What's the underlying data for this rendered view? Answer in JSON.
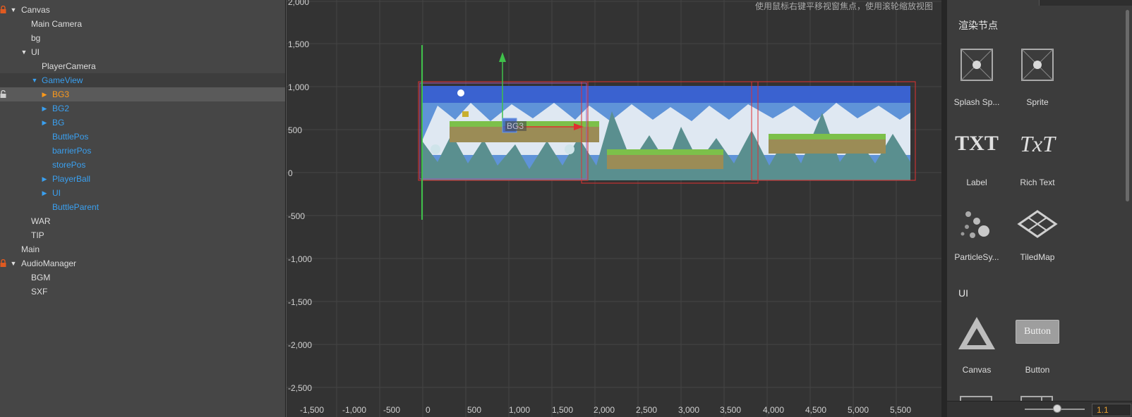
{
  "hierarchy": {
    "nodes": [
      {
        "label": "Canvas",
        "color": "#e6e6e6"
      },
      {
        "label": "Main Camera",
        "color": "#e6e6e6"
      },
      {
        "label": "bg",
        "color": "#e6e6e6"
      },
      {
        "label": "UI",
        "color": "#e6e6e6"
      },
      {
        "label": "PlayerCamera",
        "color": "#e6e6e6"
      },
      {
        "label": "GameView",
        "color": "#3aa0f0"
      },
      {
        "label": "BG3",
        "color": "#ff9a1a"
      },
      {
        "label": "BG2",
        "color": "#3aa0f0"
      },
      {
        "label": "BG",
        "color": "#3aa0f0"
      },
      {
        "label": "ButtlePos",
        "color": "#3aa0f0"
      },
      {
        "label": "barrierPos",
        "color": "#3aa0f0"
      },
      {
        "label": "storePos",
        "color": "#3aa0f0"
      },
      {
        "label": "PlayerBall",
        "color": "#3aa0f0"
      },
      {
        "label": "UI",
        "color": "#3aa0f0"
      },
      {
        "label": "ButtleParent",
        "color": "#3aa0f0"
      },
      {
        "label": "WAR",
        "color": "#e6e6e6"
      },
      {
        "label": "TIP",
        "color": "#e6e6e6"
      },
      {
        "label": "Main",
        "color": "#e6e6e6"
      },
      {
        "label": "AudioManager",
        "color": "#e6e6e6"
      },
      {
        "label": "BGM",
        "color": "#e6e6e6"
      },
      {
        "label": "SXF",
        "color": "#e6e6e6"
      }
    ]
  },
  "scene": {
    "hint": "使用鼠标右键平移视窗焦点，使用滚轮缩放视图",
    "y_ticks": [
      "2,000",
      "1,500",
      "1,000",
      "500",
      "0",
      "-500",
      "-1,000",
      "-1,500",
      "-2,000",
      "-2,500"
    ],
    "x_ticks": [
      "-1,500",
      "-1,000",
      "-500",
      "0",
      "500",
      "1,000",
      "1,500",
      "2,000",
      "2,500",
      "3,000",
      "3,500",
      "4,000",
      "4,500",
      "5,000",
      "5,500"
    ],
    "selected_node_label": "BG3",
    "colors": {
      "sky": "#3a62d0",
      "mountain": "#dfe8f2",
      "tree": "#5a8f8f",
      "grass": "#7cc04a",
      "selection": "#e03030",
      "gizmo_y": "#3fc04a",
      "gizmo_x": "#e03030"
    }
  },
  "library": {
    "section_render": "渲染节点",
    "section_ui": "UI",
    "render_items": [
      {
        "label": "Splash Sp...",
        "icon": "splash-sprite-icon"
      },
      {
        "label": "Sprite",
        "icon": "sprite-icon"
      },
      {
        "label": "Label",
        "icon": "label-txt-icon"
      },
      {
        "label": "Rich Text",
        "icon": "rich-text-icon"
      },
      {
        "label": "ParticleSy...",
        "icon": "particle-system-icon"
      },
      {
        "label": "TiledMap",
        "icon": "tiledmap-icon"
      }
    ],
    "ui_items": [
      {
        "label": "Canvas",
        "icon": "canvas-triangle-icon"
      },
      {
        "label": "Button",
        "icon": "button-icon"
      }
    ],
    "button_icon_text": "Button",
    "txt_icon_text": "TXT",
    "richtext_icon_text": "TxT",
    "zoom_value": "1.1"
  }
}
